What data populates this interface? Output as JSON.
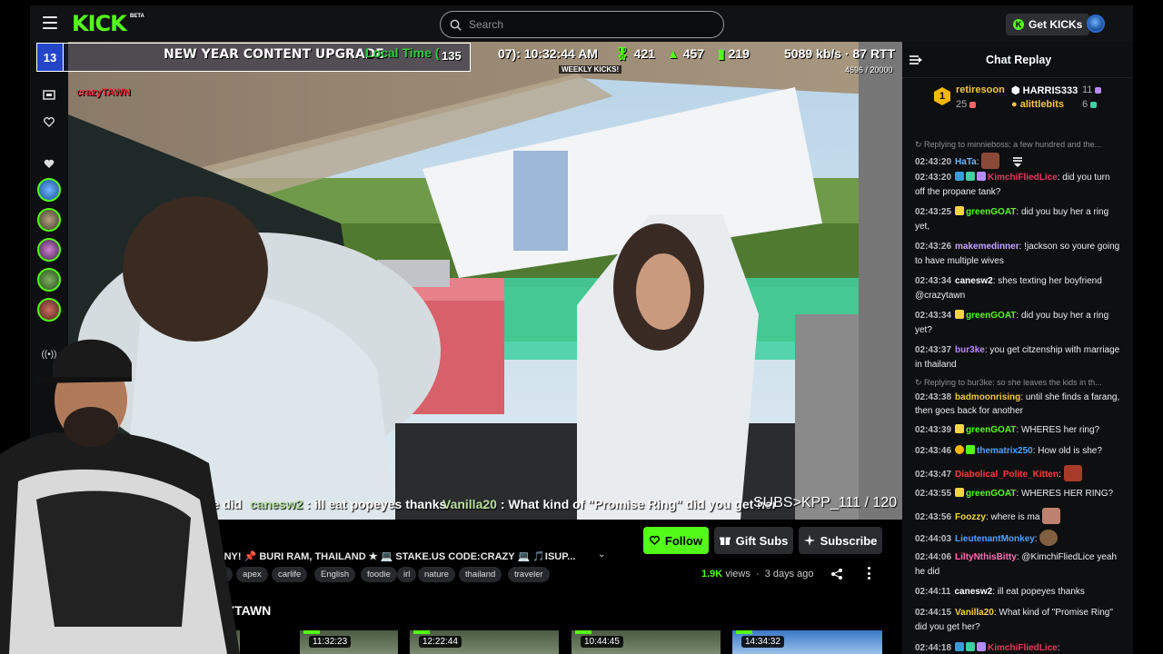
{
  "header": {
    "logo_text": "KICK",
    "logo_beta": "BETA",
    "search_placeholder": "Search",
    "get_kicks_label": "Get KICKs"
  },
  "overlay": {
    "day_number": "13",
    "banner_title": "NEW YEAR CONTENT UPGRADE",
    "local_time_label": "Local Time (",
    "counter_135": "135",
    "time_value": "07): 10:32:44 AM",
    "stat_kicks": "421",
    "stat_up": "457",
    "stat_bars": "219",
    "bitrate": "5089 kb/s · 87 RTT",
    "weekly_kicks": "WEEKLY KICKS!",
    "weekly_count": "4696  / 20000",
    "streamer_tag": "crazyTAWN",
    "ticker": [
      {
        "name": "",
        "text": "he did"
      },
      {
        "name": "canesw2",
        "text": " : ill eat popeyes thanks"
      },
      {
        "name": "Vanilla20",
        "text": " : What kind of \"Promise Ring\" did you get her"
      }
    ],
    "subs": "SUBS>KPP_111 / 120"
  },
  "actions": {
    "follow": "Follow",
    "gift_subs": "Gift Subs",
    "subscribe": "Subscribe"
  },
  "stream": {
    "title": "PDA      MONY! 📌 BURI RAM, THAILAND ★ 💻 STAKE.US CODE:CRAZY 💻 🎵ISUP...",
    "tags": [
      "h",
      "18+",
      "apex",
      "carlife",
      "English",
      "foodie",
      "irl",
      "nature",
      "thailand",
      "traveler"
    ],
    "views_count": "1.9K",
    "views_label": "views",
    "age": "3 days ago",
    "more_from": "om CRAZYTAWN",
    "thumbnails": [
      "11:32:23",
      "12:22:44",
      "10:44:45",
      "14:34:32"
    ]
  },
  "chat": {
    "title": "Chat Replay",
    "pinned": [
      {
        "rank": "1",
        "name": "retiresoon",
        "count": "25"
      },
      {
        "name": "HARRIS333",
        "count": "11"
      },
      {
        "name": "alittlebits",
        "count": "6"
      }
    ],
    "messages": [
      {
        "reply": "↻ Replying to minnieboss: a few hundred and the...",
        "time": "02:43:20",
        "user": "HaTa",
        "color": "#6fb6ff",
        "text": ":"
      },
      {
        "time": "02:43:20",
        "user": "KimchiFliedLice",
        "color": "#e23c5c",
        "text": ": did you turn off the propane tank?"
      },
      {
        "time": "02:43:25",
        "user": "greenGOAT",
        "color": "#53fc18",
        "text": ": did you buy her a ring yet,"
      },
      {
        "time": "02:43:26",
        "user": "makemedinner",
        "color": "#c7a5ff",
        "text": ": !jackson so youre going to have multiple wives"
      },
      {
        "time": "02:43:34",
        "user": "canesw2",
        "color": "#ffffff",
        "text": ": shes texting her boyfriend @crazytawn"
      },
      {
        "time": "02:43:34",
        "user": "greenGOAT",
        "color": "#53fc18",
        "text": ": did you buy her a ring yet?"
      },
      {
        "time": "02:43:37",
        "user": "bur3ke",
        "color": "#b98aff",
        "text": ": you get citzenship with marriage in thailand"
      },
      {
        "reply": "↻ Replying to bur3ke: so she leaves the kids in th...",
        "time": "02:43:38",
        "user": "badmoonrising",
        "color": "#f5c542",
        "text": ": until she finds a farang, then goes back for another"
      },
      {
        "time": "02:43:39",
        "user": "greenGOAT",
        "color": "#53fc18",
        "text": ": WHERES her ring?"
      },
      {
        "time": "02:43:46",
        "user": "thematrix250",
        "color": "#4fa3ff",
        "text": ": How old is she?"
      },
      {
        "time": "02:43:47",
        "user": "Diabolical_Polite_Kitten",
        "color": "#ff3b3b",
        "text": ":"
      },
      {
        "time": "02:43:55",
        "user": "greenGOAT",
        "color": "#53fc18",
        "text": ": WHERES HER RING?"
      },
      {
        "time": "02:43:56",
        "user": "Foozzy",
        "color": "#f5d442",
        "text": ": where is ma"
      },
      {
        "time": "02:44:03",
        "user": "LieutenantMonkey",
        "color": "#4fa3ff",
        "text": ":"
      },
      {
        "time": "02:44:06",
        "user": "LiltyNthisBitty",
        "color": "#ff6fb5",
        "text": ": @KimchiFliedLice yeah he did"
      },
      {
        "time": "02:44:11",
        "user": "canesw2",
        "color": "#ffffff",
        "text": ": ill eat popeyes thanks"
      },
      {
        "time": "02:44:15",
        "user": "Vanilla20",
        "color": "#f5d442",
        "text": ": What kind of \"Promise Ring\" did you get her?"
      },
      {
        "time": "02:44:18",
        "user": "KimchiFliedLice",
        "color": "#e23c5c",
        "text": ":"
      }
    ]
  },
  "colors": {
    "brand": "#53fc18",
    "bg": "#000000",
    "panel": "#0e0f11"
  }
}
